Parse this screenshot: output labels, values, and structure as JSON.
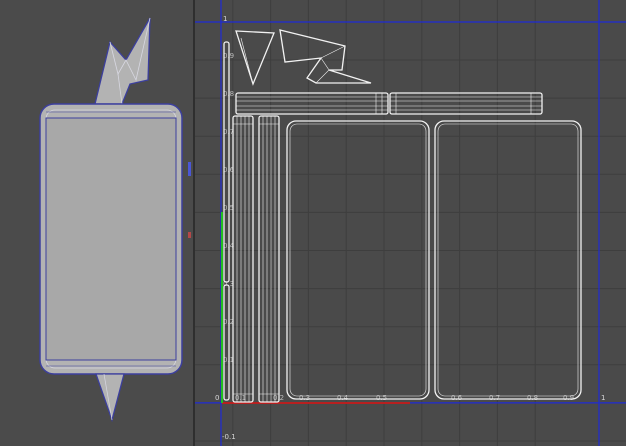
{
  "viewport": {
    "mesh_fill": "#b3b3b3",
    "mesh_outline": "#3c3f9e",
    "mesh_edge": "#d8d8e2",
    "axis_blue": "#4b57d6",
    "axis_red": "#b44848"
  },
  "uv_editor": {
    "background": "#4a4a4a",
    "grid_color": "#3e3e3e",
    "shell_color": "#f2f2f2",
    "u_axis_color": "#b82020",
    "v_axis_color": "#1fbf1f",
    "frame_color": "#1e2bd6",
    "v_ticks": [
      {
        "label": "1",
        "axis": true
      },
      {
        "label": "0.9"
      },
      {
        "label": "0.8"
      },
      {
        "label": "0.7"
      },
      {
        "label": "0.6"
      },
      {
        "label": "0.5"
      },
      {
        "label": "0.4"
      },
      {
        "label": "0.3"
      },
      {
        "label": "0.2"
      },
      {
        "label": "0.1"
      }
    ],
    "u_ticks": [
      {
        "label": "0.1"
      },
      {
        "label": "0.2"
      },
      {
        "label": "0.3"
      },
      {
        "label": "0.4"
      },
      {
        "label": "0.5"
      },
      {
        "label": "0.6"
      },
      {
        "label": "0.7"
      },
      {
        "label": "0.8"
      },
      {
        "label": "0.9"
      },
      {
        "label": "1",
        "axis": true
      }
    ],
    "origin_label": "0",
    "negative_label": "-0.1"
  }
}
